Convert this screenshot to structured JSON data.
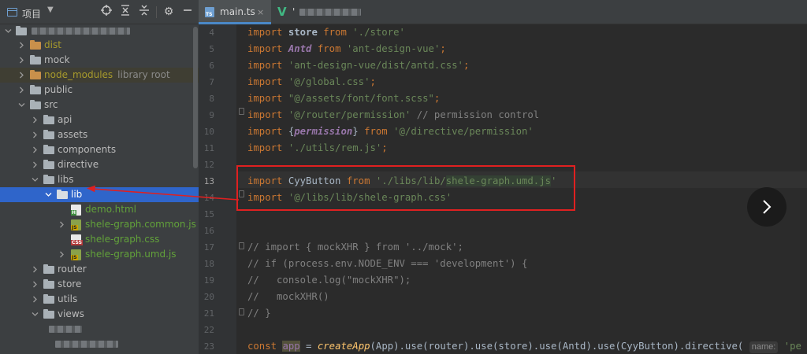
{
  "project_panel": {
    "title": "项目",
    "toolbar_icons": [
      "locate-icon",
      "expand-all-icon",
      "collapse-all-icon",
      "gear-icon",
      "minimize-icon"
    ],
    "tree": {
      "dist": "dist",
      "mock": "mock",
      "node_modules": "node_modules",
      "node_modules_hint": "library root",
      "public": "public",
      "src": "src",
      "api": "api",
      "assets": "assets",
      "components": "components",
      "directive": "directive",
      "libs": "libs",
      "lib": "lib",
      "demo_html": "demo.html",
      "common_js": "shele-graph.common.js",
      "css": "shele-graph.css",
      "umd_js": "shele-graph.umd.js",
      "router": "router",
      "store": "store",
      "utils": "utils",
      "views": "views"
    }
  },
  "editor": {
    "tabs": [
      {
        "label": "main.ts",
        "close": "×"
      },
      {
        "label": "'"
      }
    ],
    "line_numbers": [
      "4",
      "5",
      "6",
      "7",
      "8",
      "9",
      "10",
      "11",
      "12",
      "13",
      "14",
      "15",
      "16",
      "17",
      "18",
      "19",
      "20",
      "21",
      "22",
      "23"
    ],
    "code": {
      "l4_kw": "import",
      "l4_id": " store ",
      "l4_from": "from",
      "l4_str": " './store'",
      "l4_end": "",
      "l5_kw": "import",
      "l5_id": "Antd",
      "l5_from": "from",
      "l5_str": "'ant-design-vue'",
      "l5_end": ";",
      "l6_kw": "import",
      "l6_str": "'ant-design-vue/dist/antd.css'",
      "l6_end": ";",
      "l7_kw": "import",
      "l7_str": "'@/global.css'",
      "l7_end": ";",
      "l8_kw": "import",
      "l8_str": "\"@/assets/font/font.scss\"",
      "l8_end": ";",
      "l9_kw": "import",
      "l9_str": "'@/router/permission'",
      "l9_cm": "// permission control",
      "l10_kw": "import",
      "l10_open": "{",
      "l10_id": "permission",
      "l10_close": "}",
      "l10_from": "from",
      "l10_str": "'@/directive/permission'",
      "l11_kw": "import",
      "l11_str": "'./utils/rem.js'",
      "l11_end": ";",
      "l13_kw": "import",
      "l13_id": "CyyButton",
      "l13_from": "from",
      "l13_str_a": "'./libs/lib/",
      "l13_str_b": "shele-graph.umd.js",
      "l13_str_c": "'",
      "l14_kw": "import",
      "l14_str": "'@/libs/lib/shele-graph.css'",
      "l17": "// import { mockXHR } from '../mock';",
      "l18": "// if (process.env.NODE_ENV === 'development') {",
      "l19": "//   console.log(\"mockXHR\");",
      "l20": "//   mockXHR()",
      "l21": "// }",
      "l23_kw": "const",
      "l23_var": "app",
      "l23_eq": " = ",
      "l23_fn": "createApp",
      "l23_rest": "(App).use(router).use(store).use(Antd).use(CyyButton).directive(",
      "l23_hint": "name:",
      "l23_tail": "'pe"
    }
  },
  "colors": {
    "keyword": "#cc7832",
    "string": "#6a8759",
    "comment": "#808080",
    "selection": "#2f65ca",
    "annotation": "#e02020"
  }
}
